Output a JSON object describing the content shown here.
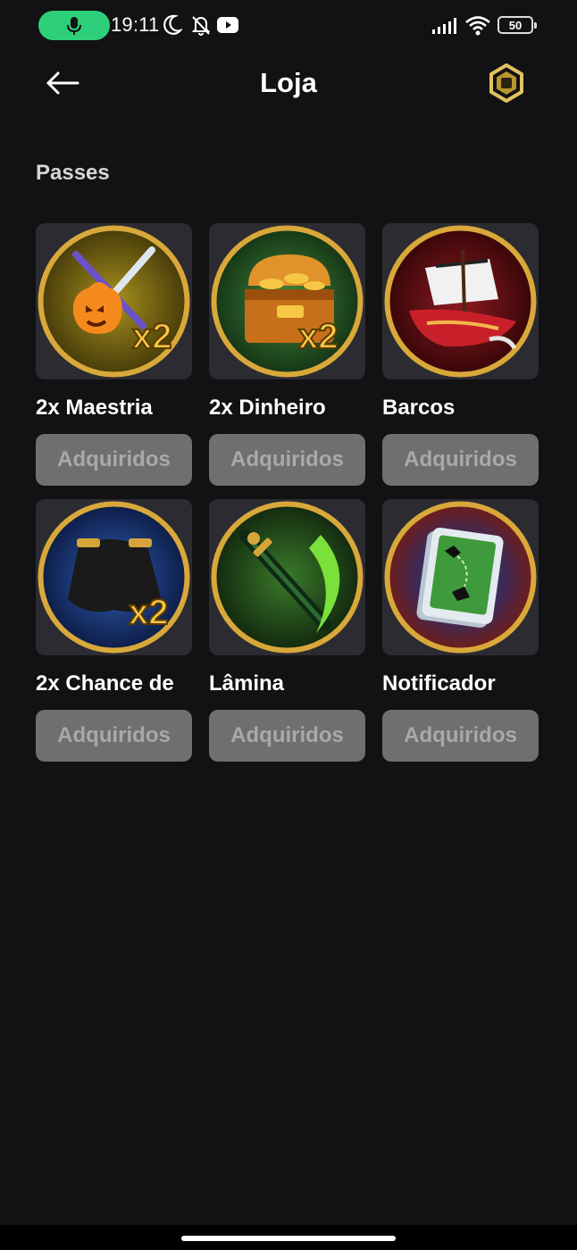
{
  "status_bar": {
    "time": "19:11",
    "battery": "50",
    "icons": [
      "microphone-icon",
      "moon-icon",
      "bell-off-icon",
      "youtube-icon",
      "signal-icon",
      "wifi-icon",
      "battery-icon"
    ],
    "accent": "#2ecf7a"
  },
  "header": {
    "title": "Loja",
    "back_icon": "arrow-left-icon",
    "currency_icon": "robux-icon"
  },
  "section": {
    "title": "Passes"
  },
  "items": [
    {
      "name": "2x Maestria",
      "button": "Adquiridos",
      "icon": "pass-mastery-icon"
    },
    {
      "name": "2x Dinheiro",
      "button": "Adquiridos",
      "icon": "pass-money-icon"
    },
    {
      "name": "Barcos",
      "button": "Adquiridos",
      "icon": "pass-boats-icon"
    },
    {
      "name": "2x Chance de",
      "button": "Adquiridos",
      "icon": "pass-drop-chance-icon"
    },
    {
      "name": "Lâmina",
      "button": "Adquiridos",
      "icon": "pass-blade-icon"
    },
    {
      "name": "Notificador",
      "button": "Adquiridos",
      "icon": "pass-notifier-icon"
    }
  ],
  "colors": {
    "background": "#121214",
    "card": "#2b2b31",
    "button_disabled": "#6f6f72",
    "button_text": "#a9a9ac"
  }
}
